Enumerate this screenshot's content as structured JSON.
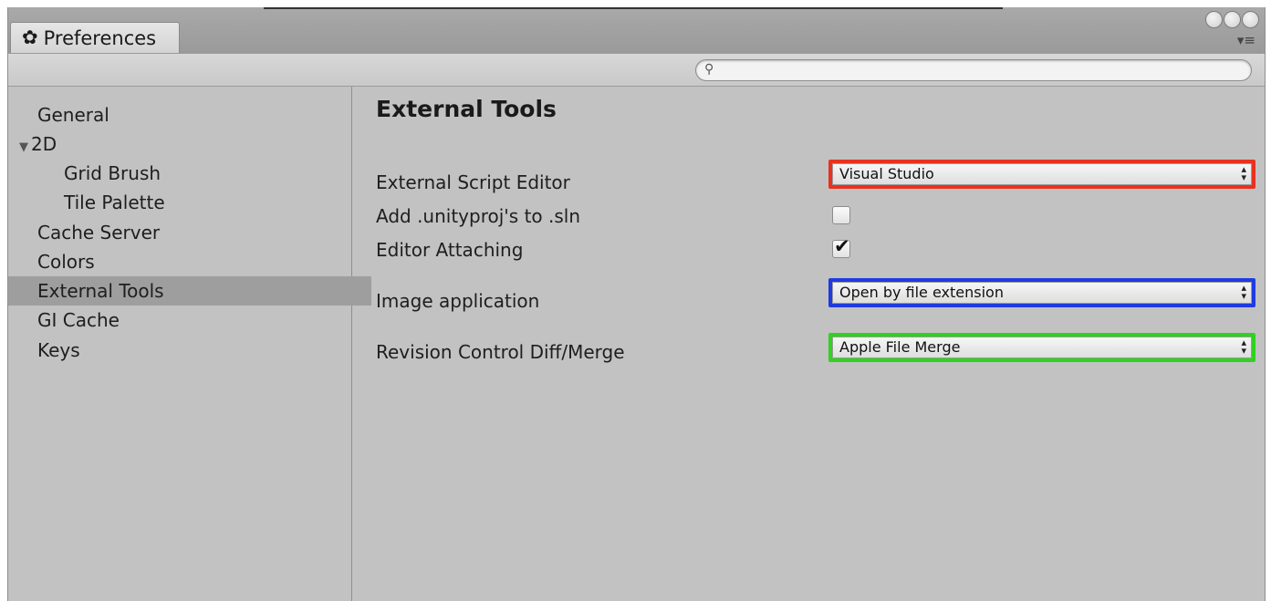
{
  "window": {
    "tab_icon": "gear-icon",
    "tab_title": "Preferences",
    "menu_icon": "▾≡"
  },
  "search": {
    "placeholder": "",
    "value": "",
    "icon": "search-icon"
  },
  "sidebar": {
    "items": [
      {
        "label": "General",
        "selected": false
      },
      {
        "label": "2D",
        "selected": false,
        "expanded": true
      },
      {
        "label": "Grid Brush",
        "selected": false
      },
      {
        "label": "Tile Palette",
        "selected": false
      },
      {
        "label": "Cache Server",
        "selected": false
      },
      {
        "label": "Colors",
        "selected": false
      },
      {
        "label": "External Tools",
        "selected": true
      },
      {
        "label": "GI Cache",
        "selected": false
      },
      {
        "label": "Keys",
        "selected": false
      }
    ],
    "expand_icon": "▼"
  },
  "main": {
    "title": "External Tools",
    "settings": {
      "script_editor": {
        "label": "External Script Editor",
        "value": "Visual Studio",
        "highlight_color": "#e8321e"
      },
      "add_unityproj": {
        "label": "Add .unityproj's to .sln",
        "checked": false
      },
      "editor_attaching": {
        "label": "Editor Attaching",
        "checked": true,
        "check_glyph": "✔"
      },
      "image_application": {
        "label": "Image application",
        "value": "Open by file extension",
        "highlight_color": "#1f3be0"
      },
      "revision_control": {
        "label": "Revision Control Diff/Merge",
        "value": "Apple File Merge",
        "highlight_color": "#2fd21e"
      }
    },
    "dropdown_arrows": "▲▼"
  }
}
